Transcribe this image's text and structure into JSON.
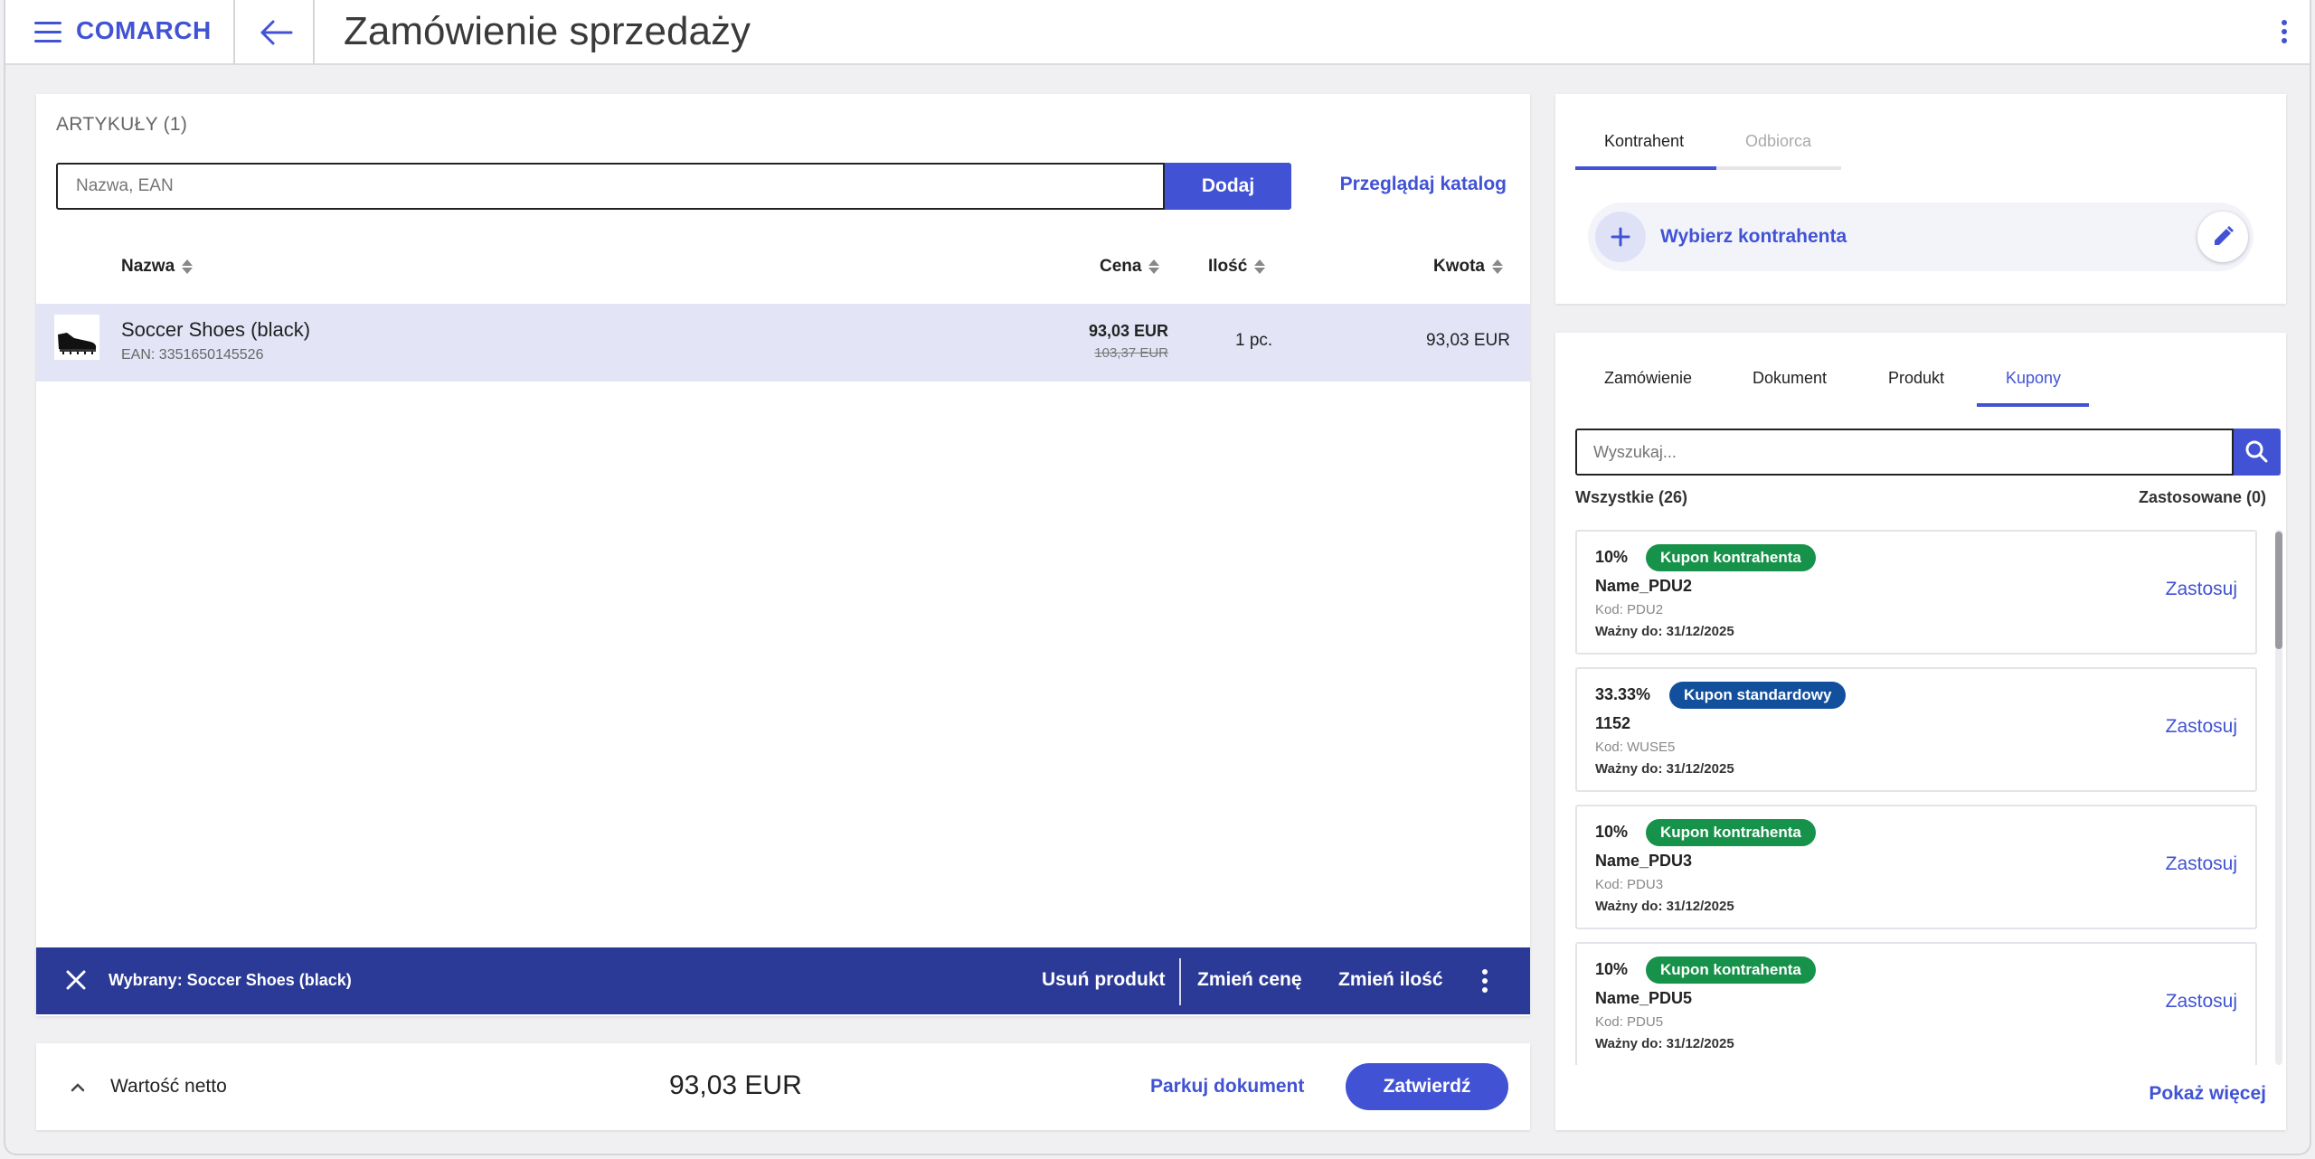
{
  "header": {
    "logo": "COMARCH",
    "title": "Zamówienie sprzedaży"
  },
  "articles": {
    "section_title": "ARTYKUŁY (1)",
    "search_placeholder": "Nazwa, EAN",
    "add_label": "Dodaj",
    "catalog_link": "Przeglądaj katalog",
    "columns": {
      "name": "Nazwa",
      "price": "Cena",
      "qty": "Ilość",
      "amount": "Kwota"
    },
    "items": [
      {
        "name": "Soccer Shoes (black)",
        "ean": "EAN: 3351650145526",
        "price": "93,03 EUR",
        "old_price": "103,37 EUR",
        "qty": "1 pc.",
        "amount": "93,03 EUR"
      }
    ],
    "selection_bar": {
      "label": "Wybrany: Soccer Shoes (black)",
      "remove": "Usuń produkt",
      "change_price": "Zmień cenę",
      "change_qty": "Zmień ilość"
    }
  },
  "summary": {
    "label": "Wartość netto",
    "value": "93,03 EUR",
    "park": "Parkuj dokument",
    "confirm": "Zatwierdź"
  },
  "party": {
    "tabs": [
      "Kontrahent",
      "Odbiorca"
    ],
    "choose_label": "Wybierz kontrahenta"
  },
  "coupons": {
    "tabs": [
      "Zamówienie",
      "Dokument",
      "Produkt",
      "Kupony"
    ],
    "search_placeholder": "Wyszukaj...",
    "count_all": "Wszystkie (26)",
    "count_applied": "Zastosowane (0)",
    "apply_label": "Zastosuj",
    "show_more": "Pokaż więcej",
    "list": [
      {
        "pct": "10%",
        "badge": "Kupon kontrahenta",
        "badge_color": "#17924a",
        "name": "Name_PDU2",
        "code": "Kod: PDU2",
        "valid": "Ważny do: 31/12/2025"
      },
      {
        "pct": "33.33%",
        "badge": "Kupon standardowy",
        "badge_color": "#124f9c",
        "name": "1152",
        "code": "Kod: WUSE5",
        "valid": "Ważny do: 31/12/2025"
      },
      {
        "pct": "10%",
        "badge": "Kupon kontrahenta",
        "badge_color": "#17924a",
        "name": "Name_PDU3",
        "code": "Kod: PDU3",
        "valid": "Ważny do: 31/12/2025"
      },
      {
        "pct": "10%",
        "badge": "Kupon kontrahenta",
        "badge_color": "#17924a",
        "name": "Name_PDU5",
        "code": "Kod: PDU5",
        "valid": "Ważny do: 31/12/2025"
      }
    ]
  },
  "colors": {
    "accent": "#4153d4",
    "selection_bar": "#2b3a96",
    "selected_row": "#e3e5f7"
  }
}
